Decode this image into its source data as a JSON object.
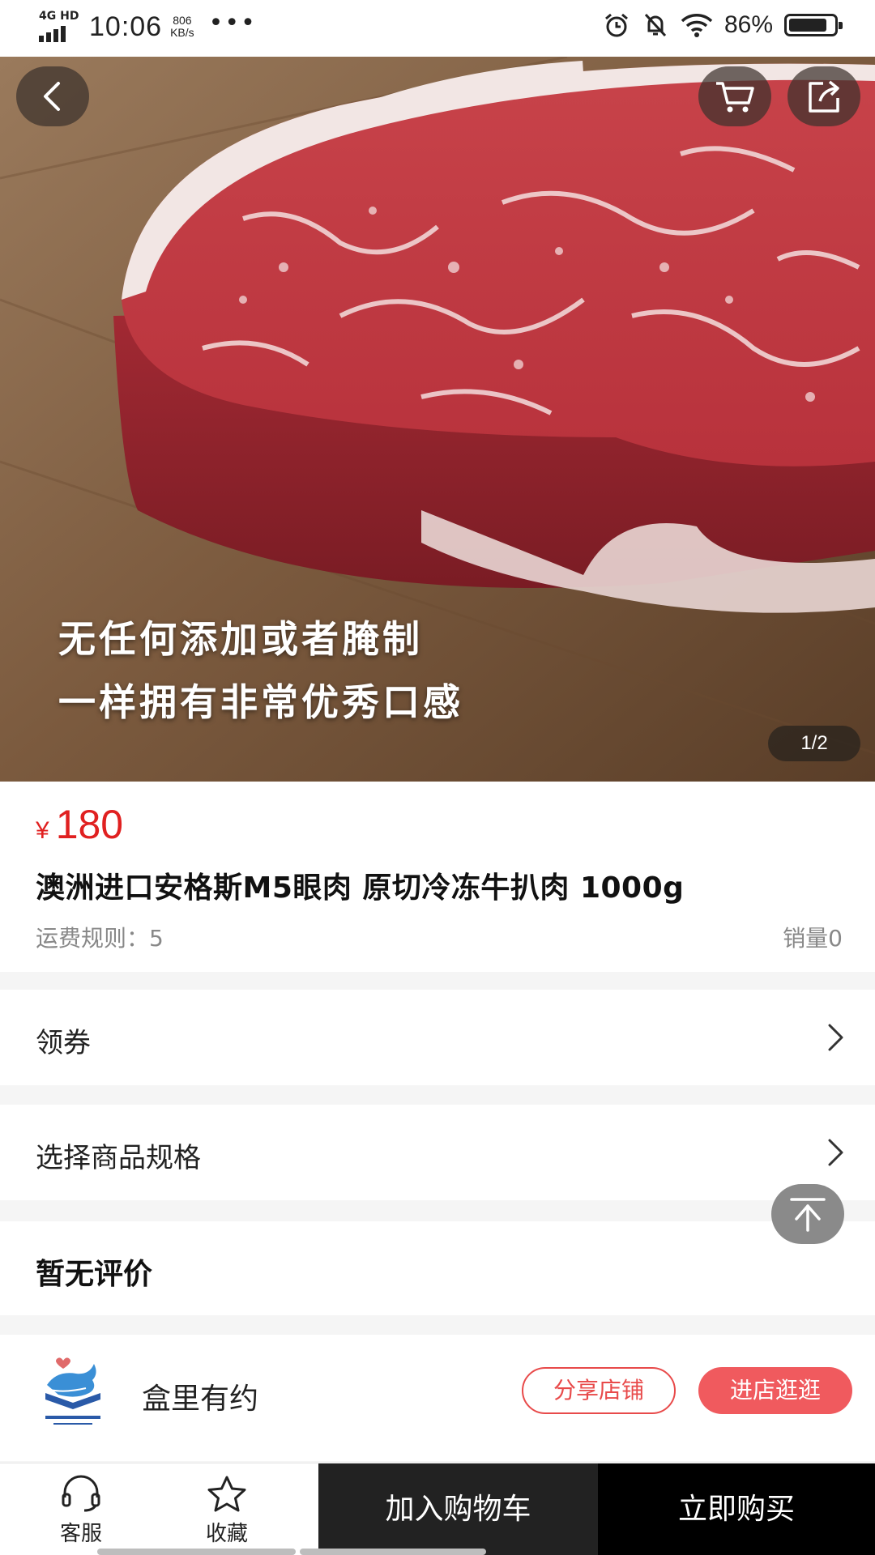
{
  "status_bar": {
    "network": "4G HD",
    "time": "10:06",
    "speed_value": "806",
    "speed_unit": "KB/s",
    "more": "•••",
    "battery_percent": "86%",
    "battery_level": 0.86
  },
  "hero": {
    "caption_line1": "无任何添加或者腌制",
    "caption_line2": "一样拥有非常优秀口感",
    "pager": "1/2"
  },
  "product": {
    "currency": "¥",
    "price": "180",
    "title": "澳洲进口安格斯M5眼肉 原切冷冻牛扒肉 1000g",
    "freight": "运费规则：5",
    "sales": "销量0"
  },
  "rows": {
    "coupon": "领券",
    "spec": "选择商品规格"
  },
  "reviews": {
    "label": "暂无评价"
  },
  "shop": {
    "name": "盒里有约",
    "share_label": "分享店铺",
    "enter_label": "进店逛逛"
  },
  "bottom_bar": {
    "service_label": "客服",
    "favorite_label": "收藏",
    "add_cart_label": "加入购物车",
    "buy_now_label": "立即购买"
  },
  "colors": {
    "price_red": "#e02020",
    "accent_red": "#f05a5e",
    "dark": "#222222"
  },
  "icons": {
    "back": "chevron-left-icon",
    "cart": "cart-icon",
    "share": "share-icon",
    "chevron": "chevron-right-icon",
    "top": "scroll-top-icon",
    "service": "headset-icon",
    "favorite": "star-icon"
  }
}
